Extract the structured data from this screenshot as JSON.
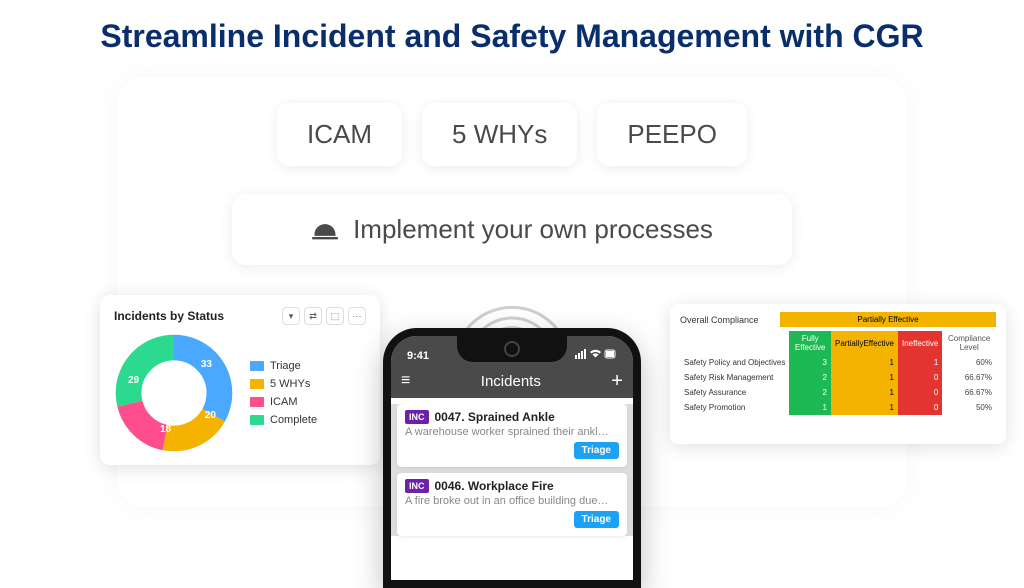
{
  "headline": "Streamline Incident and Safety Management with CGR",
  "pills": {
    "icam": "ICAM",
    "whys": "5 WHYs",
    "peepo": "PEEPO"
  },
  "implement_label": "Implement your own processes",
  "donut": {
    "title": "Incidents by Status",
    "tools": [
      "▾",
      "⇄",
      "⬚",
      "···"
    ],
    "legend": [
      "Triage",
      "5 WHYs",
      "ICAM",
      "Complete"
    ]
  },
  "chart_data": {
    "type": "pie",
    "title": "Incidents by Status",
    "series": [
      {
        "name": "Triage",
        "value": 33,
        "color": "#4aa8ff"
      },
      {
        "name": "5 WHYs",
        "value": 20,
        "color": "#f5b301"
      },
      {
        "name": "ICAM",
        "value": 18,
        "color": "#ff4d8d"
      },
      {
        "name": "Complete",
        "value": 29,
        "color": "#2bd98f"
      }
    ]
  },
  "phone": {
    "time": "9:41",
    "app_title": "Incidents",
    "items": [
      {
        "badge": "INC",
        "title": "0047. Sprained Ankle",
        "desc": "A warehouse worker sprained their ankl…",
        "tag": "Triage"
      },
      {
        "badge": "INC",
        "title": "0046. Workplace Fire",
        "desc": "A fire broke out in an office building due…",
        "tag": "Triage"
      }
    ]
  },
  "compliance": {
    "title": "Overall Compliance",
    "banner": "Partially Effective",
    "headers": {
      "green": "Fully Effective",
      "yellow": "PartiallyEffective",
      "red": "Ineffective",
      "level": "Compliance Level"
    },
    "rows": [
      {
        "label": "Safety Policy and Objectives",
        "g": 3,
        "y": 1,
        "r": 1,
        "level": "60%"
      },
      {
        "label": "Safety Risk Management",
        "g": 2,
        "y": 1,
        "r": 0,
        "level": "66.67%"
      },
      {
        "label": "Safety Assurance",
        "g": 2,
        "y": 1,
        "r": 0,
        "level": "66.67%"
      },
      {
        "label": "Safety Promotion",
        "g": 1,
        "y": 1,
        "r": 0,
        "level": "50%"
      }
    ]
  }
}
